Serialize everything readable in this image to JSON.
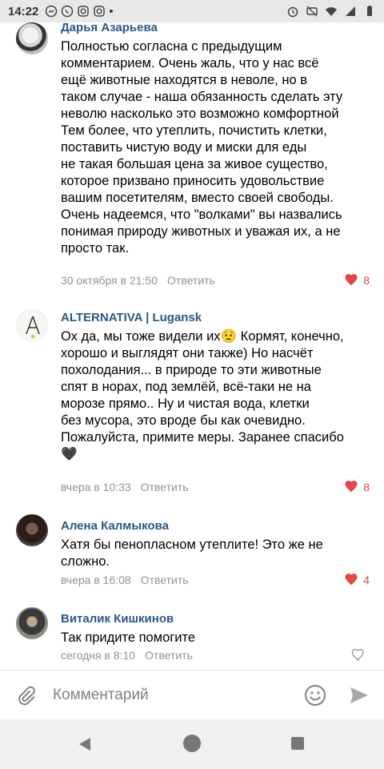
{
  "status_bar": {
    "time": "14:22",
    "dot": "•"
  },
  "comments": [
    {
      "author": "Дарья Азарьева",
      "text": "Полностью согласна с предыдущим\nкомментарием. Очень жаль, что у нас всё\nещё животные находятся в неволе, но в\nтаком случае - наша обязанность сделать эту\nневолю насколько это возможно комфортной\nТем более, что утеплить, почистить клетки,\nпоставить чистую воду и миски для еды\nне такая большая цена за живое существо,\nкоторое призвано приносить удовольствие\nвашим посетителям, вместо своей свободы.\nОчень надеемся, что \"волками\" вы назвались\nпонимая природу животных и уважая их, а не\nпросто так.",
      "date": "30 октября в 21:50",
      "reply": "Ответить",
      "likes": "8",
      "liked": true
    },
    {
      "author": "ALTERNATIVA | Lugansk",
      "text": "Ох да, мы тоже видели их😟 Кормят, конечно,\nхорошо и выглядят они также) Но насчёт\nпохолодания... в природе то эти животные\nспят в норах, под землёй, всё-таки не на\nморозе прямо.. Ну и чистая вода, клетки\nбез мусора, это вроде бы как очевидно.\nПожалуйста, примите меры. Заранее спасибо\n🖤",
      "date": "вчера в 10:33",
      "reply": "Ответить",
      "likes": "8",
      "liked": true
    },
    {
      "author": "Алена Калмыкова",
      "text": "Хатя бы пенопласном утеплите! Это же не\nсложно.",
      "date": "вчера в 16:08",
      "reply": "Ответить",
      "likes": "4",
      "liked": true
    },
    {
      "author": "Виталик Кишкинов",
      "text": "Так придите помогите",
      "date": "сегодня в 8:10",
      "reply": "Ответить",
      "likes": "",
      "liked": false
    }
  ],
  "input": {
    "placeholder": "Комментарий"
  },
  "colors": {
    "link": "#2a5885",
    "like": "#e64646",
    "meta": "#939393"
  }
}
